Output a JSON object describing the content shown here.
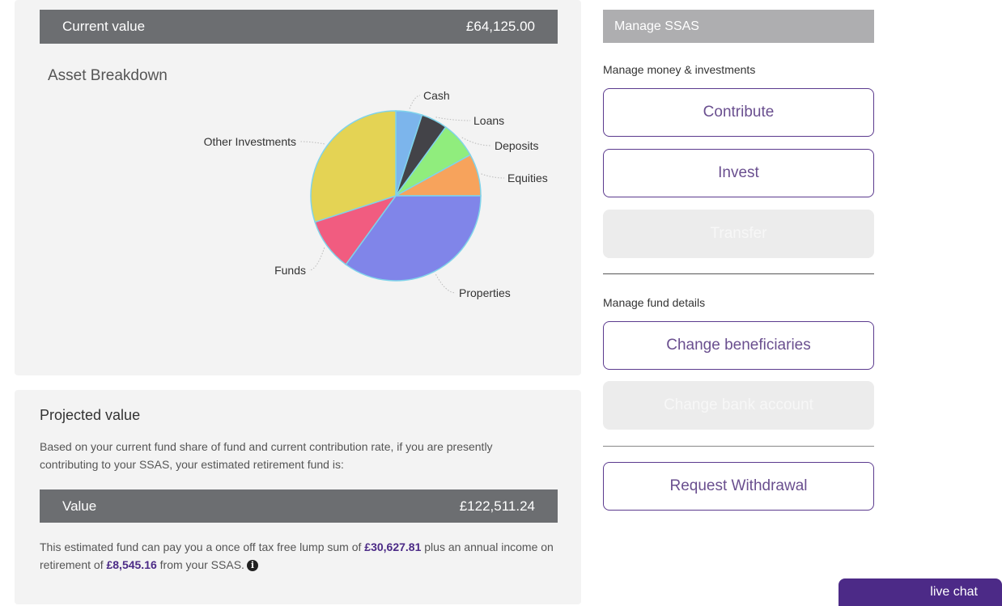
{
  "current": {
    "label": "Current value",
    "amount": "£64,125.00"
  },
  "asset_breakdown": {
    "title": "Asset Breakdown"
  },
  "chart_data": {
    "type": "pie",
    "title": "Asset Breakdown",
    "slices": [
      {
        "label": "Cash",
        "value": 5,
        "color": "#7cb5ec"
      },
      {
        "label": "Loans",
        "value": 5,
        "color": "#434348"
      },
      {
        "label": "Deposits",
        "value": 7,
        "color": "#90ed7d"
      },
      {
        "label": "Equities",
        "value": 8,
        "color": "#f7a35c"
      },
      {
        "label": "Properties",
        "value": 35,
        "color": "#8085e9"
      },
      {
        "label": "Funds",
        "value": 10,
        "color": "#f15c80"
      },
      {
        "label": "Other Investments",
        "value": 30,
        "color": "#e4d354"
      }
    ]
  },
  "projected": {
    "title": "Projected value",
    "description": "Based on your current fund share of fund and current contribution rate, if you are presently contributing to your SSAS, your estimated retirement fund is:",
    "value_label": "Value",
    "value_amount": "£122,511.24",
    "lump_prefix": "This estimated fund can pay you a once off tax free lump sum of ",
    "lump_amount": "£30,627.81",
    "lump_mid": " plus an annual income on retirement of ",
    "income_amount": "£8,545.16",
    "lump_suffix": " from your SSAS.",
    "info_glyph": "i"
  },
  "manage": {
    "header": "Manage SSAS",
    "money_label": "Manage money & investments",
    "contribute": "Contribute",
    "invest": "Invest",
    "transfer": "Transfer",
    "fund_label": "Manage fund details",
    "change_beneficiaries": "Change beneficiaries",
    "change_bank": "Change bank account",
    "request_withdrawal": "Request Withdrawal"
  },
  "live_chat": "live chat"
}
